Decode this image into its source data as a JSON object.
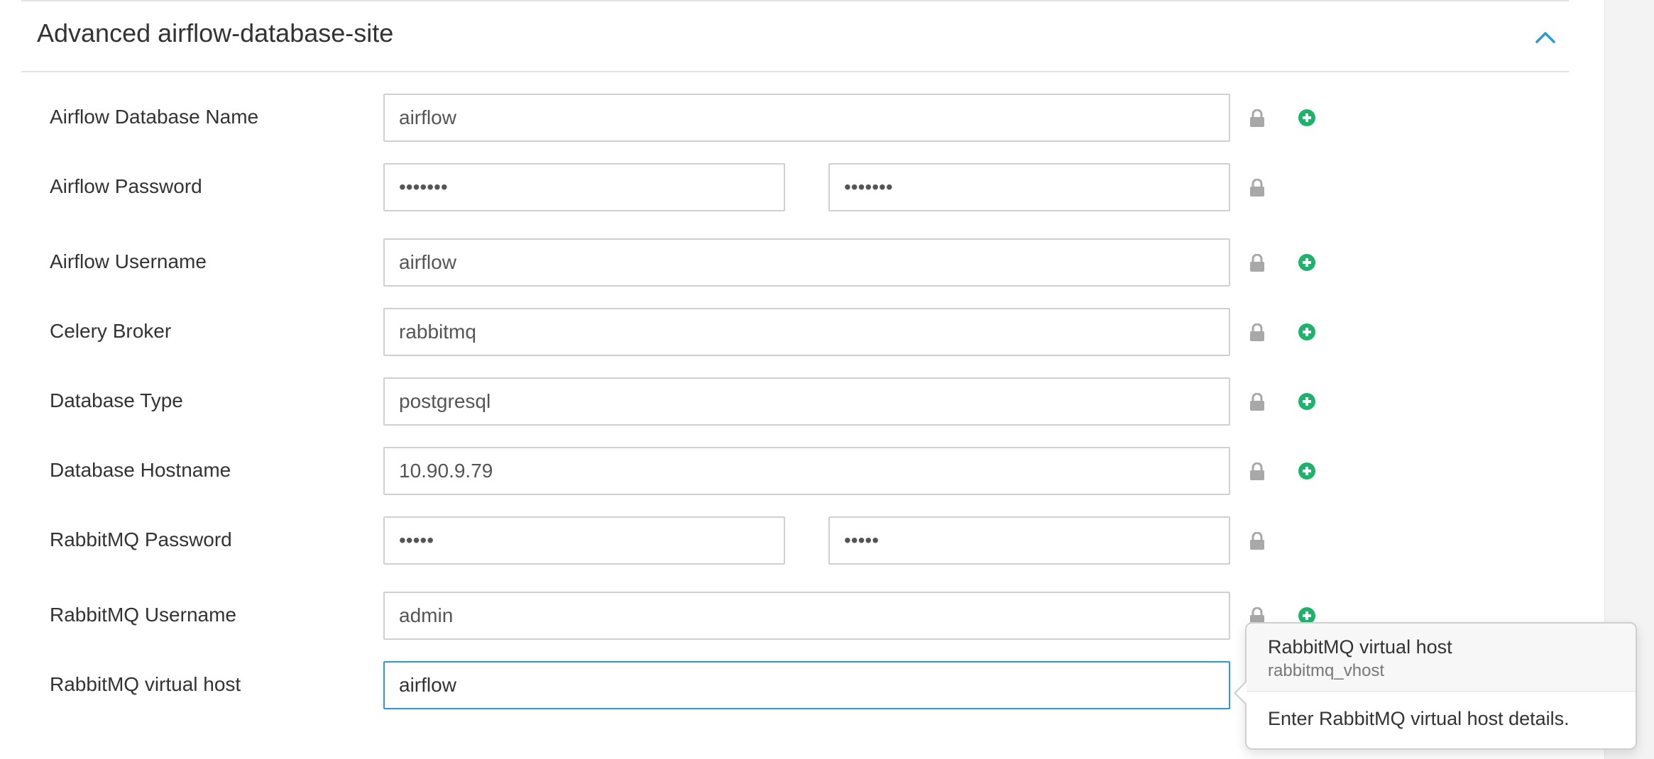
{
  "panel": {
    "title": "Advanced airflow-database-site",
    "collapse_icon": "chevron-up-icon"
  },
  "icons": {
    "lock": "lock-icon",
    "add": "plus-circle-icon"
  },
  "colors": {
    "accent": "#2a9ad4",
    "add_green": "#1eb36b",
    "lock_gray": "#a8a8a8"
  },
  "fields": [
    {
      "label": "Airflow Database Name",
      "value": "airflow"
    },
    {
      "label": "Airflow Password",
      "value": "•••••••",
      "confirm": "•••••••"
    },
    {
      "label": "Airflow Username",
      "value": "airflow"
    },
    {
      "label": "Celery Broker",
      "value": "rabbitmq"
    },
    {
      "label": "Database Type",
      "value": "postgresql"
    },
    {
      "label": "Database Hostname",
      "value": "10.90.9.79"
    },
    {
      "label": "RabbitMQ Password",
      "value": "•••••",
      "confirm": "•••••"
    },
    {
      "label": "RabbitMQ Username",
      "value": "admin"
    },
    {
      "label": "RabbitMQ virtual host",
      "value": "airflow"
    }
  ],
  "popover": {
    "title": "RabbitMQ virtual host",
    "subtitle": "rabbitmq_vhost",
    "body": "Enter RabbitMQ virtual host details."
  }
}
